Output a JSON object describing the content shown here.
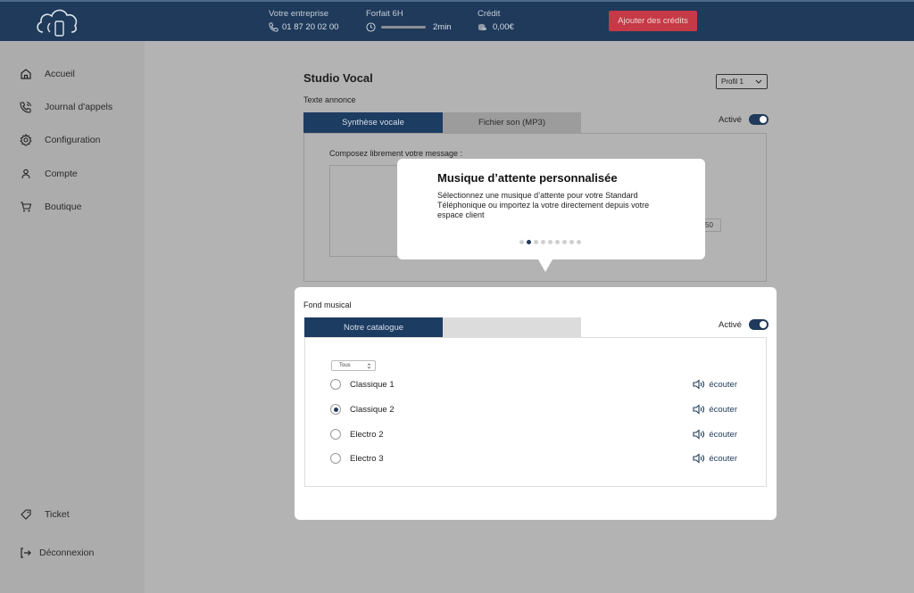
{
  "header": {
    "company_label": "Votre entreprise",
    "phone": "01 87 20 02 00",
    "plan_label": "Forfait 6H",
    "plan_remaining": "2min",
    "plan_used_fraction": 0.99,
    "credit_label": "Crédit",
    "credit_value": "0,00€",
    "add_credit_button": "Ajouter des crédits"
  },
  "sidebar": {
    "items": [
      {
        "label": "Accueil",
        "icon": "home-icon"
      },
      {
        "label": "Journal d'appels",
        "icon": "phone-call-icon"
      },
      {
        "label": "Configuration",
        "icon": "gear-icon"
      },
      {
        "label": "Compte",
        "icon": "user-icon"
      },
      {
        "label": "Boutique",
        "icon": "cart-icon"
      }
    ],
    "bottom": [
      {
        "label": "Ticket",
        "icon": "ticket-icon"
      },
      {
        "label": "Déconnexion",
        "icon": "logout-icon"
      }
    ]
  },
  "main": {
    "title": "Studio Vocal",
    "profile_select": "Profil 1",
    "announce_label": "Texte annonce",
    "tabs": [
      {
        "label": "Synthèse vocale",
        "active": true
      },
      {
        "label": "Fichier son (MP3)",
        "active": false
      }
    ],
    "active_label": "Activé",
    "compose_label": "Composez librement votre message :",
    "char_counter": "50"
  },
  "popup": {
    "title": "Musique d’attente personnalisée",
    "description": "Sélectionnez une musique d’attente pour votre Standard Téléphonique ou importez la votre directement depuis votre espace client",
    "step_current": 2,
    "step_total": 9
  },
  "music": {
    "section_label": "Fond musical",
    "tab_catalogue": "Notre catalogue",
    "tab_second": "",
    "active_label": "Activé",
    "filter_value": "Tous",
    "listen_label": "écouter",
    "tracks": [
      {
        "name": "Classique 1",
        "selected": false
      },
      {
        "name": "Classique 2",
        "selected": true
      },
      {
        "name": "Electro 2",
        "selected": false
      },
      {
        "name": "Electro 3",
        "selected": false
      }
    ]
  },
  "colors": {
    "brand": "#1f3a5a",
    "accent_red": "#c53a46"
  }
}
